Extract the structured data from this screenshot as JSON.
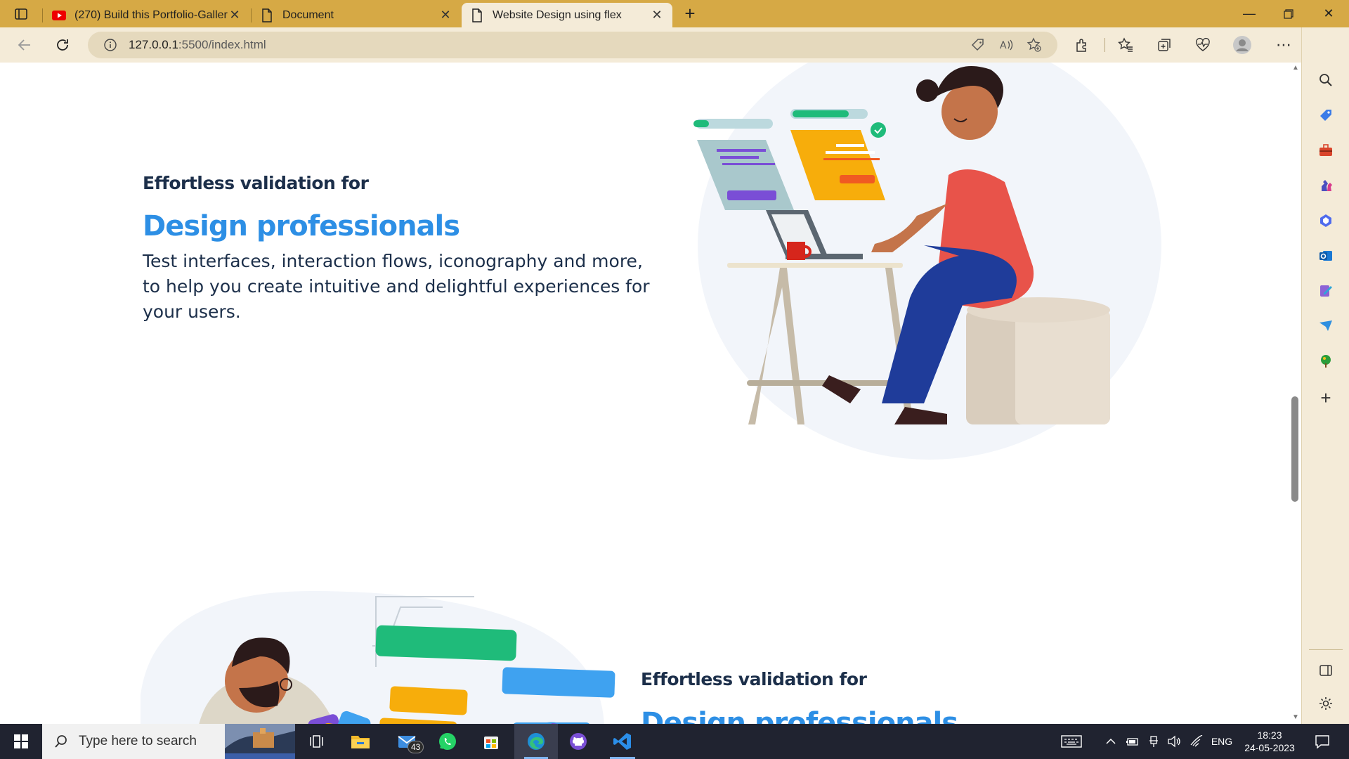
{
  "browser": {
    "tabs": [
      {
        "title": "(270) Build this Portfolio-Gallery",
        "icon": "youtube-icon"
      },
      {
        "title": "Document",
        "icon": "page-icon"
      },
      {
        "title": "Website Design using flex",
        "icon": "page-icon"
      }
    ],
    "new_tab": "+",
    "address": {
      "host": "127.0.0.1",
      "path": ":5500/index.html"
    },
    "colors": {
      "frame": "#d6a945",
      "toolbar": "#f4ebd8"
    }
  },
  "page": {
    "section1": {
      "kicker": "Effortless validation for",
      "title": "Design professionals",
      "body": "Test interfaces, interaction flows, iconography and more, to help you create intuitive and delightful experiences for your users."
    },
    "section2": {
      "kicker": "Effortless validation for",
      "title": "Design professionals"
    },
    "colors": {
      "heading": "#1c2f4a",
      "accent": "#2d8fe5"
    }
  },
  "taskbar": {
    "search_placeholder": "Type here to search",
    "mail_badge": "43",
    "language": "ENG",
    "time": "18:23",
    "date": "24-05-2023"
  }
}
